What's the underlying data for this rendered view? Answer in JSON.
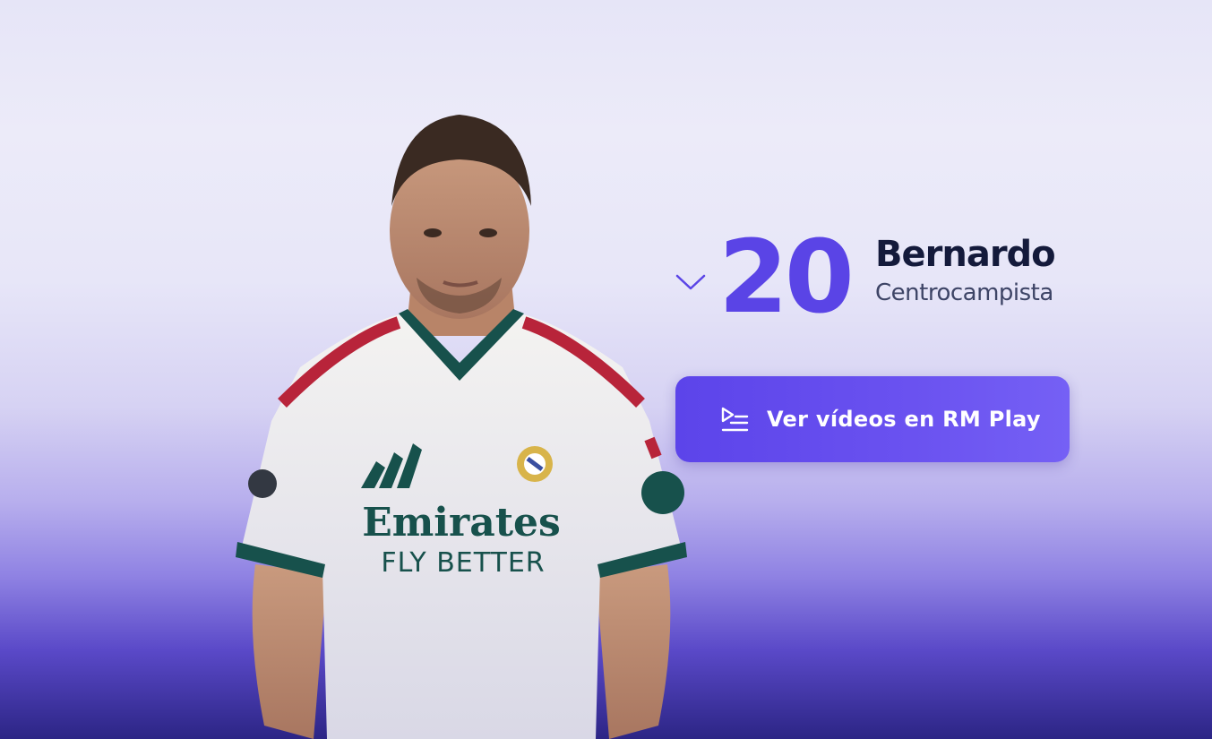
{
  "player": {
    "number": "20",
    "name": "Bernardo",
    "position": "Centrocampista",
    "jersey": {
      "sponsor_line1": "Emirates",
      "sponsor_line2": "FLY BETTER"
    }
  },
  "cta": {
    "label": "Ver vídeos en RM Play",
    "icon": "play-list-icon"
  },
  "colors": {
    "accent": "#5a44e6",
    "button": "#6a52f0",
    "name_text": "#141a3b",
    "position_text": "#3d4466"
  }
}
